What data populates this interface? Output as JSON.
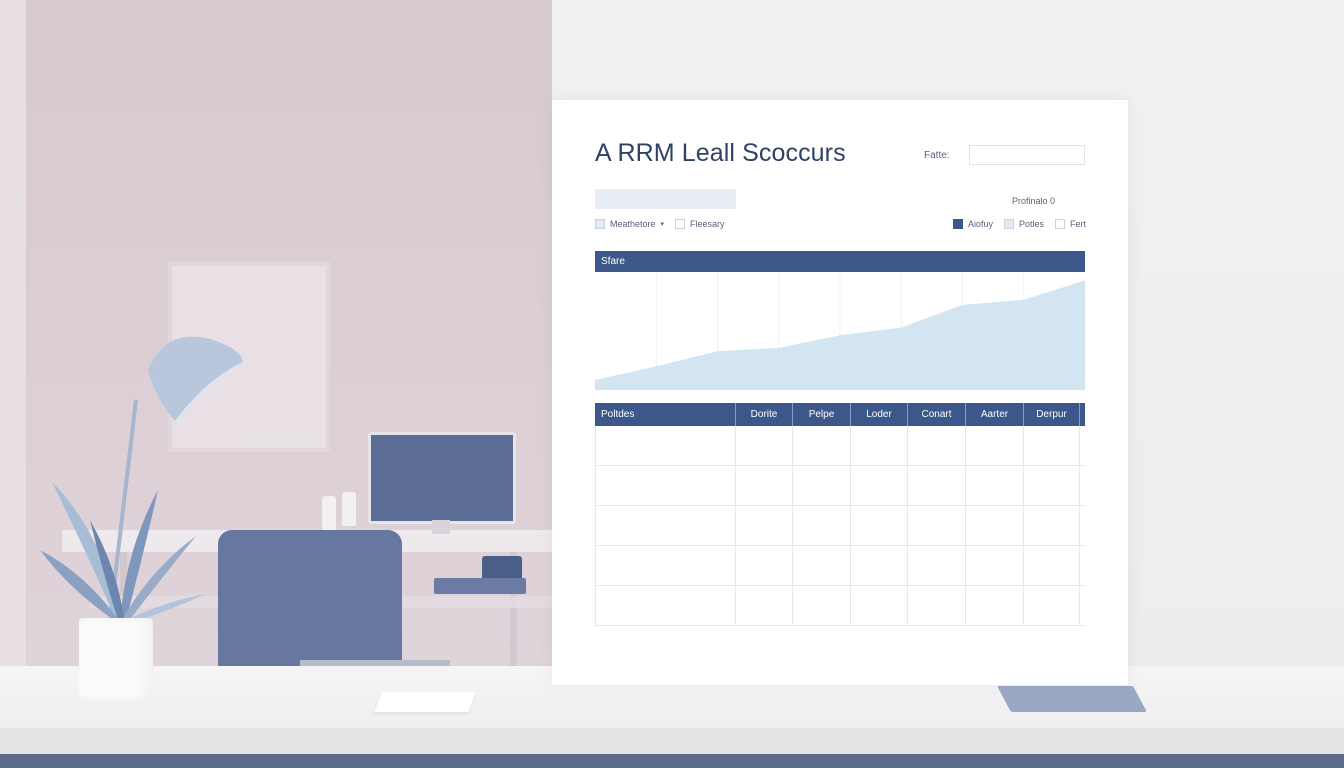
{
  "report": {
    "title": "A RRM Leall Scoccurs",
    "date_label": "Fatte:",
    "date_value": "",
    "search_value": "",
    "profile_label": "Profinalo 0",
    "filters_left": [
      {
        "label": "Meathetore",
        "has_dropdown": true,
        "checked": false
      },
      {
        "label": "Fleesary",
        "has_dropdown": false,
        "checked": false
      }
    ],
    "filters_right": [
      {
        "label": "Aiofuy",
        "checked": true
      },
      {
        "label": "Potles",
        "checked": false
      },
      {
        "label": "Fert",
        "checked": false
      }
    ],
    "dropdown_caret": "▾"
  },
  "chart_data": {
    "type": "area",
    "title": "Sfare",
    "x": [
      0,
      1,
      2,
      3,
      4,
      5,
      6,
      7,
      8
    ],
    "values": [
      12,
      28,
      46,
      50,
      65,
      74,
      101,
      107,
      130
    ],
    "ylim": [
      0,
      140
    ],
    "fill_color": "#d3e5f0",
    "grid": true
  },
  "table": {
    "columns": [
      "Poltdes",
      "Dorite",
      "Pelpe",
      "Loder",
      "Conart",
      "Aarter",
      "Derpur"
    ],
    "rows": [
      [
        "",
        "",
        "",
        "",
        "",
        "",
        ""
      ],
      [
        "",
        "",
        "",
        "",
        "",
        "",
        ""
      ],
      [
        "",
        "",
        "",
        "",
        "",
        "",
        ""
      ],
      [
        "",
        "",
        "",
        "",
        "",
        "",
        ""
      ],
      [
        "",
        "",
        "",
        "",
        "",
        "",
        ""
      ]
    ]
  },
  "colors": {
    "accent": "#3c5789",
    "title": "#2f4266",
    "chart_fill": "#d3e5f0",
    "chair": "#6678a0"
  }
}
